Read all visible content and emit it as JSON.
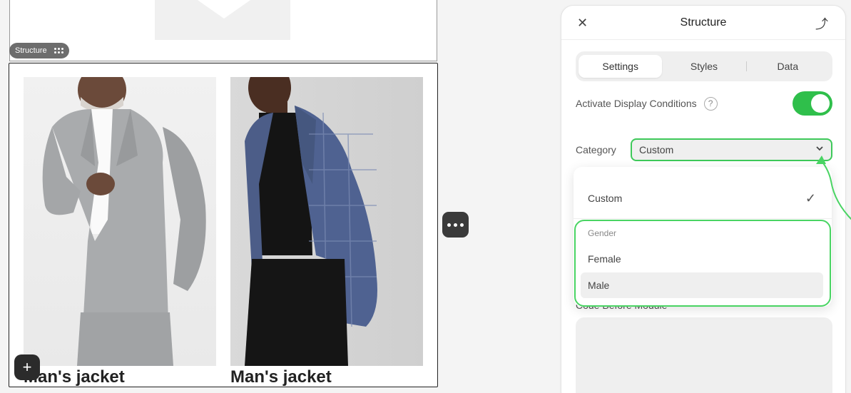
{
  "canvas": {
    "structure_chip_label": "Structure",
    "products": [
      {
        "title": "Man's jacket",
        "image": "man-in-grey-suit"
      },
      {
        "title": "Man's jacket",
        "image": "man-in-plaid-blazer"
      }
    ],
    "add_icon": "+"
  },
  "panel": {
    "title": "Structure",
    "close_icon": "✕",
    "export_icon": "⤴",
    "tabs": [
      {
        "label": "Settings",
        "active": true
      },
      {
        "label": "Styles",
        "active": false
      },
      {
        "label": "Data",
        "active": false
      }
    ],
    "activate_label": "Activate Display Conditions",
    "help_icon": "?",
    "toggle_on": true,
    "category_label": "Category",
    "category_value": "Custom",
    "chevron_icon": "⌄",
    "dropdown": {
      "custom": "Custom",
      "check_icon": "✓",
      "group_label": "Gender",
      "options": [
        "Female",
        "Male"
      ]
    },
    "code_label": "Code Before Module"
  },
  "colors": {
    "accent_green": "#2fbf4b",
    "highlight_green": "#49d463",
    "dark_button": "#2b2b2b"
  }
}
